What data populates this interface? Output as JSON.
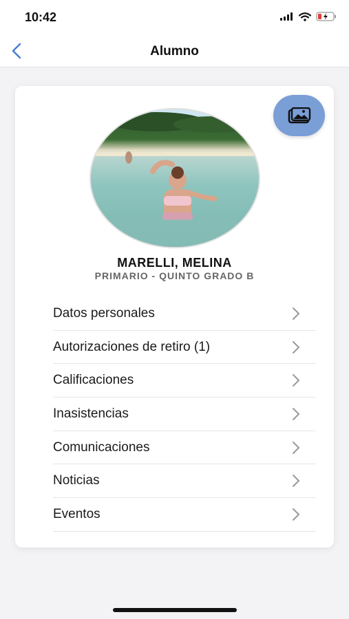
{
  "status_bar": {
    "time": "10:42"
  },
  "nav": {
    "title": "Alumno",
    "back_icon": "chevron-left-icon"
  },
  "profile": {
    "photo_button_icon": "image-icon",
    "name": "MARELLI, MELINA",
    "grade": "PRIMARIO - QUINTO GRADO B"
  },
  "menu": {
    "items": [
      {
        "label": "Datos personales"
      },
      {
        "label": "Autorizaciones de retiro (1)"
      },
      {
        "label": "Calificaciones"
      },
      {
        "label": "Inasistencias"
      },
      {
        "label": "Comunicaciones"
      },
      {
        "label": "Noticias"
      },
      {
        "label": "Eventos"
      }
    ]
  },
  "colors": {
    "accent": "#7a9ed6",
    "back_arrow": "#4a7fd1",
    "battery_low": "#e0403a"
  }
}
